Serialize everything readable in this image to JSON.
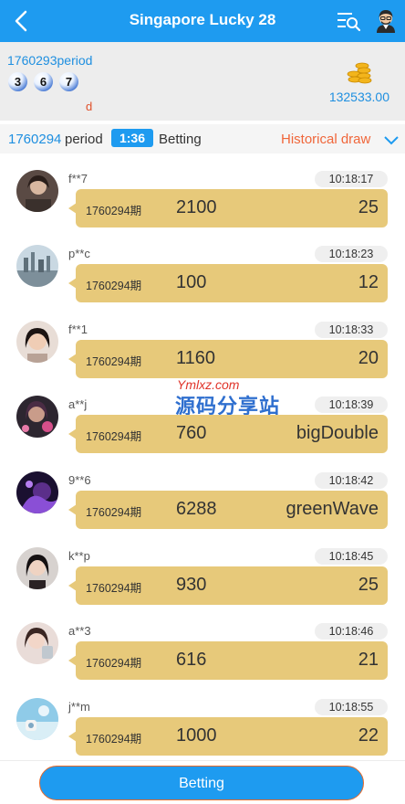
{
  "header": {
    "title": "Singapore Lucky 28",
    "back_icon": "back-arrow-icon",
    "menu_icon": "list-search-icon",
    "avatar_icon": "user-avatar-icon",
    "color": "#1e9bf0"
  },
  "last_result": {
    "period": "1760293period",
    "balls": [
      "3",
      "6",
      "7"
    ],
    "tag": "d",
    "amount": "132533.00",
    "coin_icon": "gold-coins-icon"
  },
  "current": {
    "period_number": "1760294",
    "period_label": "period",
    "countdown": "1:36",
    "status": "Betting",
    "history_link": "Historical draw"
  },
  "bets": [
    {
      "user": "f**7",
      "time": "10:18:17",
      "period": "1760294期",
      "amount": "2100",
      "pick": "25"
    },
    {
      "user": "p**c",
      "time": "10:18:23",
      "period": "1760294期",
      "amount": "100",
      "pick": "12"
    },
    {
      "user": "f**1",
      "time": "10:18:33",
      "period": "1760294期",
      "amount": "1160",
      "pick": "20"
    },
    {
      "user": "a**j",
      "time": "10:18:39",
      "period": "1760294期",
      "amount": "760",
      "pick": "bigDouble"
    },
    {
      "user": "9**6",
      "time": "10:18:42",
      "period": "1760294期",
      "amount": "6288",
      "pick": "greenWave"
    },
    {
      "user": "k**p",
      "time": "10:18:45",
      "period": "1760294期",
      "amount": "930",
      "pick": "25"
    },
    {
      "user": "a**3",
      "time": "10:18:46",
      "period": "1760294期",
      "amount": "616",
      "pick": "21"
    },
    {
      "user": "j**m",
      "time": "10:18:55",
      "period": "1760294期",
      "amount": "1000",
      "pick": "22"
    }
  ],
  "watermark": {
    "url": "Ymlxz.com",
    "text": "源码分享站"
  },
  "footer": {
    "bet_button": "Betting"
  }
}
